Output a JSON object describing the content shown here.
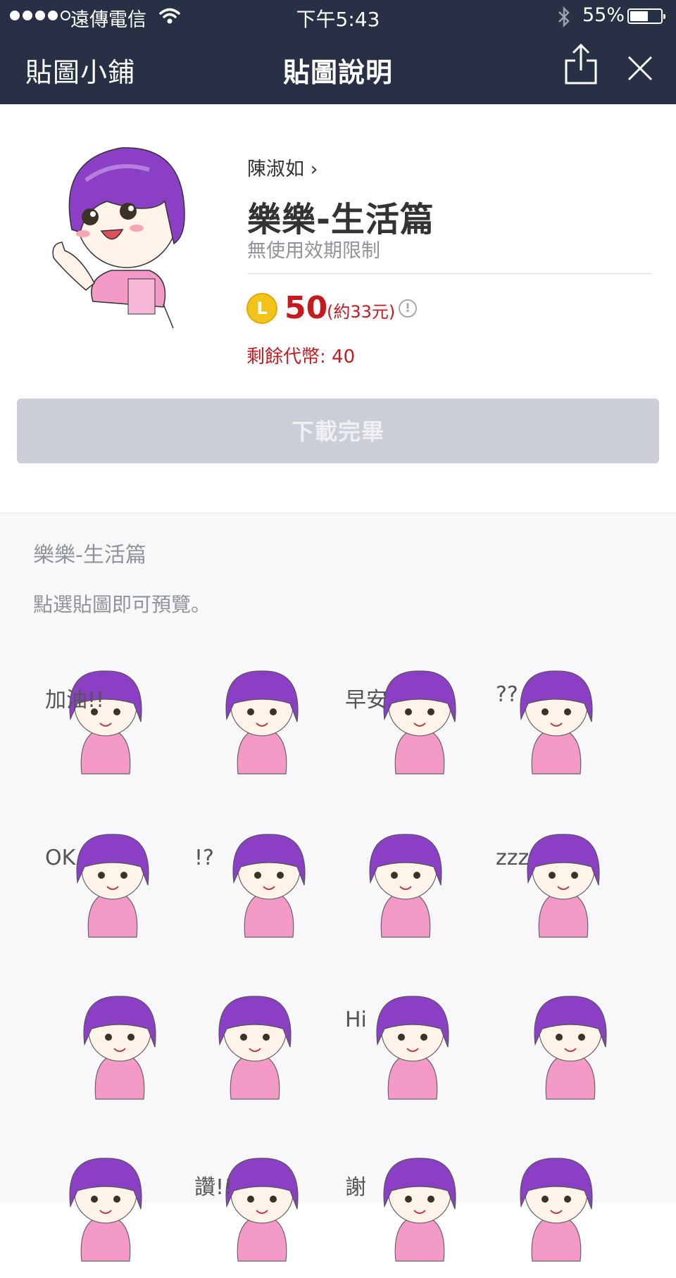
{
  "status_bar": {
    "carrier": "遠傳電信",
    "time": "下午5:43",
    "battery": "55%",
    "battery_level": 0.55
  },
  "nav": {
    "back_label": "貼圖小鋪",
    "title": "貼圖說明",
    "share_icon": "share-icon",
    "close_icon": "close-icon"
  },
  "sticker_info": {
    "author": "陳淑如",
    "title": "樂樂-生活篇",
    "validity": "無使用效期限制",
    "coin_letter": "L",
    "price": "50",
    "price_approx": "(約33元)",
    "info_mark": "!",
    "remaining_tokens": "剩餘代幣: 40"
  },
  "download_button": {
    "label": "下載完畢"
  },
  "preview_section": {
    "pack_name": "樂樂-生活篇",
    "hint": "點選貼圖即可預覽。"
  },
  "stickers": [
    {
      "caption": "加油!!"
    },
    {
      "caption": ""
    },
    {
      "caption": "早安"
    },
    {
      "caption": "??"
    },
    {
      "caption": "OK"
    },
    {
      "caption": "!?"
    },
    {
      "caption": ""
    },
    {
      "caption": "zzz"
    },
    {
      "caption": ""
    },
    {
      "caption": ""
    },
    {
      "caption": "Hi"
    },
    {
      "caption": ""
    },
    {
      "caption": ""
    },
    {
      "caption": "讚!!"
    },
    {
      "caption": "謝"
    },
    {
      "caption": ""
    }
  ],
  "colors": {
    "nav_bg": "#273044",
    "price_red": "#c8191f",
    "hair_purple": "#8a3fc4",
    "dress_pink": "#f49ac7"
  }
}
